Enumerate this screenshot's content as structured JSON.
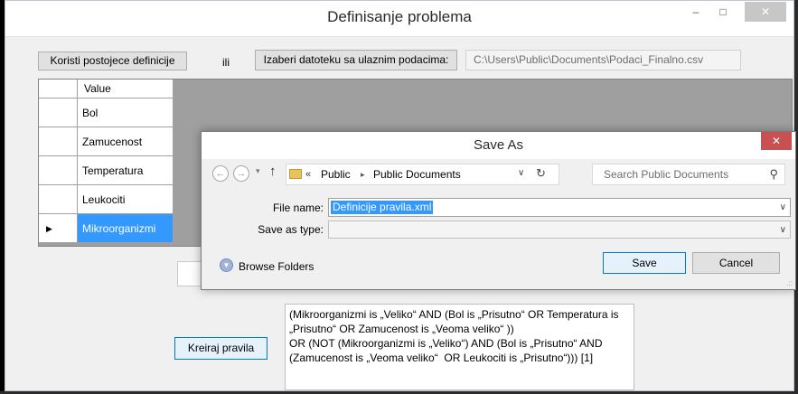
{
  "window": {
    "title": "Definisanje problema",
    "minimize": "–",
    "maximize": "□",
    "close": "✕"
  },
  "toolbar": {
    "existing_button": "Koristi postojece definicije",
    "or_label": "ili",
    "choose_file_button": "Izaberi datoteku sa ulaznim podacima:",
    "file_path": "C:\\Users\\Public\\Documents\\Podaci_Finalno.csv"
  },
  "grid": {
    "column_header": "Value",
    "rows": [
      {
        "value": "Bol",
        "selected": false
      },
      {
        "value": "Zamucenost",
        "selected": false
      },
      {
        "value": "Temperatura",
        "selected": false
      },
      {
        "value": "Leukociti",
        "selected": false
      },
      {
        "value": "Mikroorganizmi",
        "selected": true
      }
    ],
    "current_row_marker": "▶"
  },
  "create_rules_button": "Kreiraj pravila",
  "rules_text": "(Mikroorganizmi is „Veliko“ AND (Bol is „Prisutno“ OR Temperatura is „Prisutno“ OR Zamucenost is „Veoma veliko“ ))\nOR (NOT (Mikroorganizmi is „Veliko“) AND (Bol is „Prisutno“ AND (Zamucenost is „Veoma veliko“  OR Leukociti is „Prisutno“))) [1]",
  "save_dialog": {
    "title": "Save As",
    "close": "✕",
    "breadcrumb": {
      "overflow": "«",
      "separator": "▸",
      "items": [
        "Public",
        "Public Documents"
      ]
    },
    "search_placeholder": "Search Public Documents",
    "file_name_label": "File name:",
    "file_name_value": "Definicije pravila.xml",
    "save_type_label": "Save as type:",
    "save_type_value": "",
    "browse_folders_label": "Browse Folders",
    "save_button": "Save",
    "cancel_button": "Cancel"
  },
  "colors": {
    "selection": "#3399ff",
    "dialog_close": "#c75050",
    "default_button_border": "#0078d7"
  },
  "icons": [
    "back-icon",
    "forward-icon",
    "up-arrow-icon",
    "folder-icon",
    "refresh-icon",
    "search-icon",
    "chevron-down-icon",
    "expand-icon",
    "close-icon",
    "resize-grip-icon"
  ]
}
